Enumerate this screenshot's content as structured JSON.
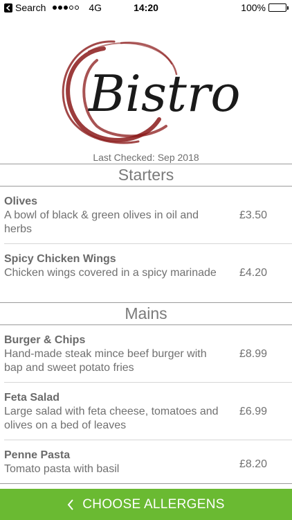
{
  "status_bar": {
    "back_label": "Search",
    "network": "4G",
    "time": "14:20",
    "battery": "100%",
    "signal_strength": 3,
    "signal_max": 5,
    "icons": [
      "back-arrow-icon",
      "signal-icon",
      "battery-icon"
    ]
  },
  "logo": {
    "text": "Bistro",
    "accent_color": "#8b1a1a"
  },
  "last_checked": "Last Checked: Sep 2018",
  "sections": [
    {
      "title": "Starters",
      "items": [
        {
          "name": "Olives",
          "description": "A bowl of black & green olives in oil and herbs",
          "price": "£3.50"
        },
        {
          "name": "Spicy Chicken Wings",
          "description": "Chicken wings covered in a spicy marinade",
          "price": "£4.20"
        }
      ]
    },
    {
      "title": "Mains",
      "items": [
        {
          "name": "Burger & Chips",
          "description": "Hand-made steak mince beef burger with bap and sweet potato fries",
          "price": "£8.99"
        },
        {
          "name": "Feta Salad",
          "description": "Large salad with feta cheese, tomatoes and olives on a bed of leaves",
          "price": "£6.99"
        },
        {
          "name": "Penne Pasta",
          "description": "Tomato pasta with basil",
          "price": "£8.20"
        }
      ]
    }
  ],
  "bottom_bar": {
    "label": "CHOOSE ALLERGENS",
    "color": "#6aba32",
    "icon": "chevron-left-icon"
  }
}
